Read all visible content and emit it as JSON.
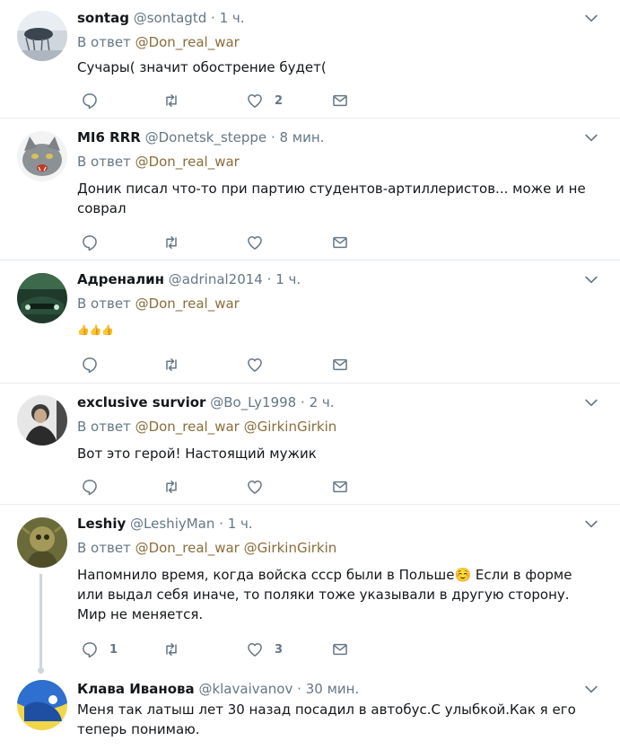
{
  "tweets": [
    {
      "name": "sontag",
      "handle": "@sontagtd",
      "dot": "·",
      "time": "1 ч.",
      "reply_prefix": "В ответ",
      "mentions": [
        "@Don_real_war"
      ],
      "text": "Сучары( значит обострение будет(",
      "reply_count": "",
      "retweet_count": "",
      "like_count": "2"
    },
    {
      "name": "MI6 RRR",
      "handle": "@Donetsk_steppe",
      "dot": "·",
      "time": "8 мин.",
      "reply_prefix": "В ответ",
      "mentions": [
        "@Don_real_war"
      ],
      "text": "Доник писал что-то при партию студентов-артиллеристов... може и не соврал",
      "reply_count": "",
      "retweet_count": "",
      "like_count": ""
    },
    {
      "name": "Адреналин",
      "handle": "@adrinal2014",
      "dot": "·",
      "time": "1 ч.",
      "reply_prefix": "В ответ",
      "mentions": [
        "@Don_real_war"
      ],
      "text": "👍👍👍",
      "reply_count": "",
      "retweet_count": "",
      "like_count": ""
    },
    {
      "name": "exclusive survior",
      "handle": "@Bo_Ly1998",
      "dot": "·",
      "time": "2 ч.",
      "reply_prefix": "В ответ",
      "mentions": [
        "@Don_real_war",
        "@GirkinGirkin"
      ],
      "text": "Вот это герой! Настоящий мужик",
      "reply_count": "",
      "retweet_count": "",
      "like_count": ""
    },
    {
      "name": "Leshiy",
      "handle": "@LeshiyMan",
      "dot": "·",
      "time": "1 ч.",
      "reply_prefix": "В ответ",
      "mentions": [
        "@Don_real_war",
        "@GirkinGirkin"
      ],
      "text": "Напомнило время, когда войска ссср были в Польше☺️ Если в форме или выдал себя иначе, то поляки тоже указывали в другую сторону. Мир не меняется.",
      "reply_count": "1",
      "retweet_count": "",
      "like_count": "3"
    },
    {
      "name": "Клава Иванова",
      "handle": "@klavaivanov",
      "dot": "·",
      "time": "30 мин.",
      "text": "Меня так латыш лет 30 назад посадил в автобус.С улыбкой.Как я его теперь понимаю."
    }
  ],
  "icons": {
    "reply": "reply-icon",
    "retweet": "retweet-icon",
    "like": "heart-icon",
    "dm": "direct-message-icon",
    "caret": "chevron-down-icon"
  },
  "colors": {
    "icon": "#657786",
    "mention": "#8a6d3b",
    "border": "#e6ecf0"
  }
}
